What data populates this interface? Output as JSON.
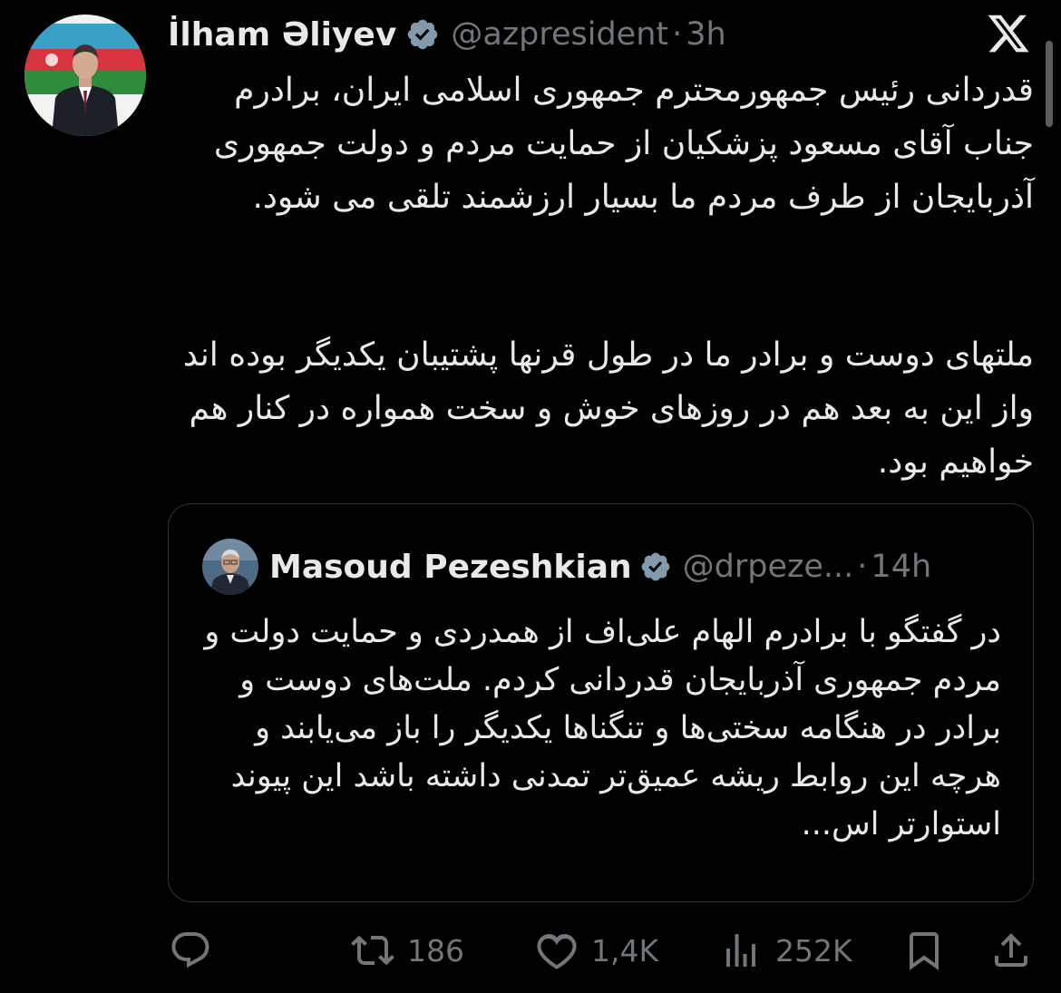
{
  "tweet": {
    "author_name": "İlham Əliyev",
    "handle": "@azpresident",
    "separator": "·",
    "time": "3h",
    "body_paragraph_1": "قدردانی رئیس جمهورمحترم جمهوری اسلامی ایران، برادرم جناب آقای مسعود پزشکیان از حمایت مردم و دولت جمهوری آذربایجان از طرف مردم ما بسیار ارزشمند تلقی می شود.",
    "body_paragraph_2": "ملتهای دوست و برادر ما در طول قرنها پشتیبان یکدیگر بوده اند واز این به بعد هم در روزهای خوش و سخت همواره در کنار هم خواهیم بود."
  },
  "quoted": {
    "author_name": "Masoud Pezeshkian",
    "handle": "@drpeze...",
    "separator": "·",
    "time": "14h",
    "text": "در گفتگو با برادرم الهام علی‌اف از همدردی و حمایت دولت و مردم جمهوری آذربایجان قدردانی کردم. ملت‌های دوست و برادر در هنگامه سختی‌ها و تنگناها یکدیگر را باز می‌یابند و هرچه این روابط ریشه عمیق‌تر تمدنی داشته باشد این پیوند استوارتر اس..."
  },
  "actions": {
    "reposts": "186",
    "likes": "1,4K",
    "views": "252K"
  },
  "icons": {
    "close": "x-logo-icon",
    "verified": "verified-badge-icon",
    "reply": "reply-icon",
    "repost": "repost-icon",
    "like": "heart-icon",
    "views": "views-icon",
    "bookmark": "bookmark-icon",
    "share": "share-icon"
  },
  "colors": {
    "background": "#000000",
    "text": "#e7e9ea",
    "muted": "#71767b",
    "border": "#2f3336"
  }
}
